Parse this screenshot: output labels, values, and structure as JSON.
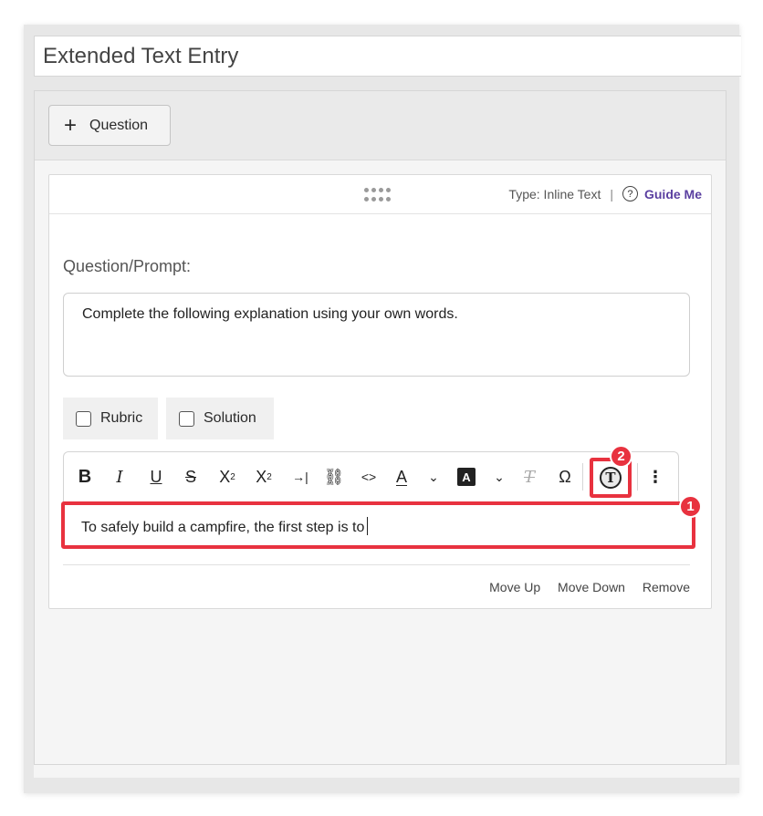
{
  "title": "Extended Text Entry",
  "toolbar": {
    "add_question_label": "Question"
  },
  "card": {
    "type_label": "Type: Inline Text",
    "type_separator": "|",
    "guide_me_label": "Guide Me",
    "prompt_label": "Question/Prompt:",
    "prompt_text": "Complete the following explanation using your own words.",
    "rubric_label": "Rubric",
    "solution_label": "Solution",
    "answer_text": "To safely build a campfire, the first step is to",
    "actions": {
      "move_up": "Move Up",
      "move_down": "Move Down",
      "remove": "Remove"
    }
  },
  "editor_toolbar": {
    "bold": "B",
    "italic": "I",
    "underline": "U",
    "strike": "S",
    "subscript": "X",
    "superscript": "X",
    "indent": "→|",
    "link": "⛓",
    "code": "<>",
    "text_color": "A",
    "bg_color": "A",
    "clear_format": "T",
    "special_char": "Ω",
    "text_entry": "T",
    "more": "⋮"
  },
  "badges": {
    "answer_field": "1",
    "text_entry_button": "2"
  },
  "colors": {
    "highlight": "#e8323f",
    "guide_link": "#5a3fa0"
  }
}
